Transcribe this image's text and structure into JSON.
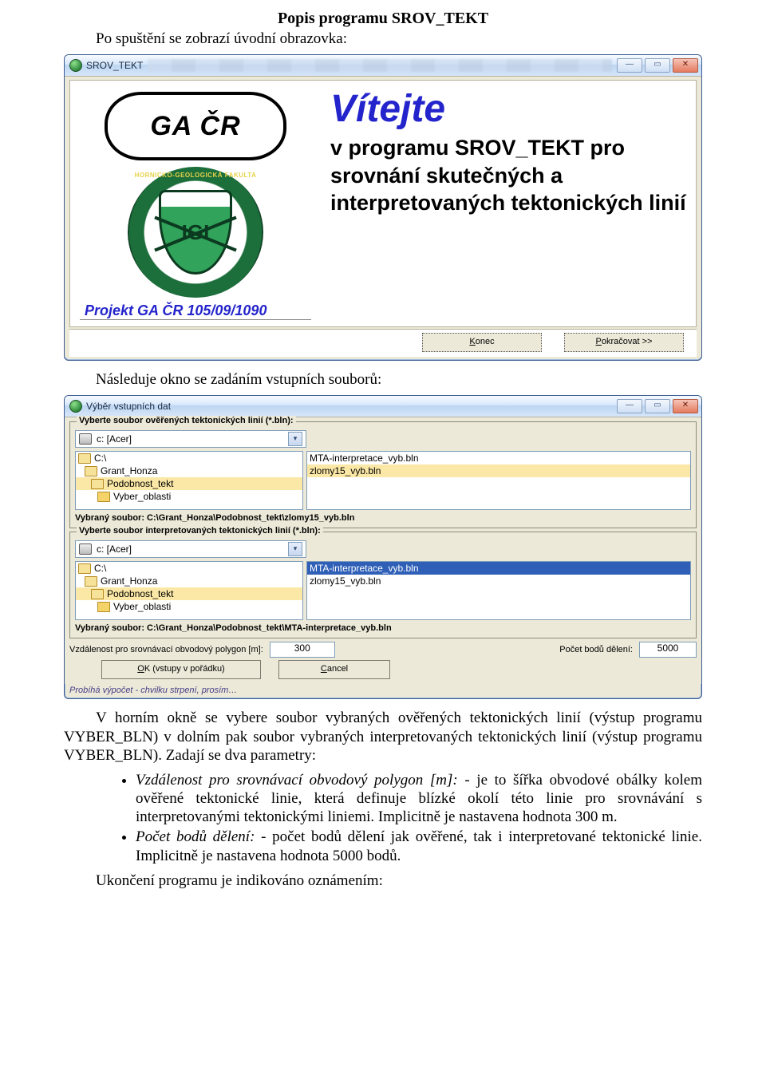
{
  "doc": {
    "title": "Popis programu SROV_TEKT",
    "p_intro": "Po spuštění se zobrazí úvodní obrazovka:",
    "p_follow": "Následuje okno se zadáním vstupních souborů:",
    "p_after": "V horním okně se vybere soubor vybraných ověřených tektonických linií (výstup programu VYBER_BLN) v dolním pak soubor vybraných interpretovaných tektonických linií (výstup programu VYBER_BLN). Zadají se dva parametry:",
    "bullet1_label": "Vzdálenost pro srovnávací obvodový polygon [m]:",
    "bullet1_body": " - je to šířka obvodové obálky kolem ověřené tektonické linie, která definuje blízké okolí této linie pro srovnávání s interpretovanými tektonickými liniemi. Implicitně je nastavena hodnota 300 m.",
    "bullet2_label": "Počet bodů dělení:",
    "bullet2_body": " - počet bodů dělení jak ověřené, tak i interpretované tektonické linie. Implicitně je nastavena hodnota 5000 bodů.",
    "p_end": "Ukončení programu je indikováno oznámením:"
  },
  "welcome": {
    "window_title": "SROV_TEKT",
    "gacr": "GA ČR",
    "igi_band": "HORNICKO-GEOLOGICKÁ FAKULTA",
    "igi_text": "IGI",
    "project": "Projekt GA ČR 105/09/1090",
    "heading": "Vítejte",
    "body": "v programu SROV_TEKT pro srovnání skutečných a interpretovaných tektonických linií",
    "btn_konec": "Konec",
    "btn_pokracovat": "Pokračovat >>"
  },
  "input": {
    "window_title": "Výběr vstupních dat",
    "group1_legend": "Vyberte soubor ověřených tektonických linií (*.bln):",
    "drive": "c: [Acer]",
    "folders": [
      "C:\\",
      "Grant_Honza",
      "Podobnost_tekt",
      "Vyber_oblasti"
    ],
    "files": [
      "MTA-interpretace_vyb.bln",
      "zlomy15_vyb.bln"
    ],
    "selected_folder_idx": 2,
    "selected_file_idx1": 1,
    "vybrany1": "Vybraný soubor: C:\\Grant_Honza\\Podobnost_tekt\\zlomy15_vyb.bln",
    "group2_legend": "Vyberte soubor interpretovaných tektonických linií (*.bln):",
    "selected_file_idx2": 0,
    "vybrany2": "Vybraný soubor: C:\\Grant_Honza\\Podobnost_tekt\\MTA-interpretace_vyb.bln",
    "dist_label": "Vzdálenost pro srovnávací obvodový polygon [m]:",
    "dist_value": "300",
    "count_label": "Počet bodů dělení:",
    "count_value": "5000",
    "btn_ok": "OK (vstupy v pořádku)",
    "btn_cancel": "Cancel",
    "status": "Probíhá výpočet - chvilku strpení, prosím…"
  }
}
